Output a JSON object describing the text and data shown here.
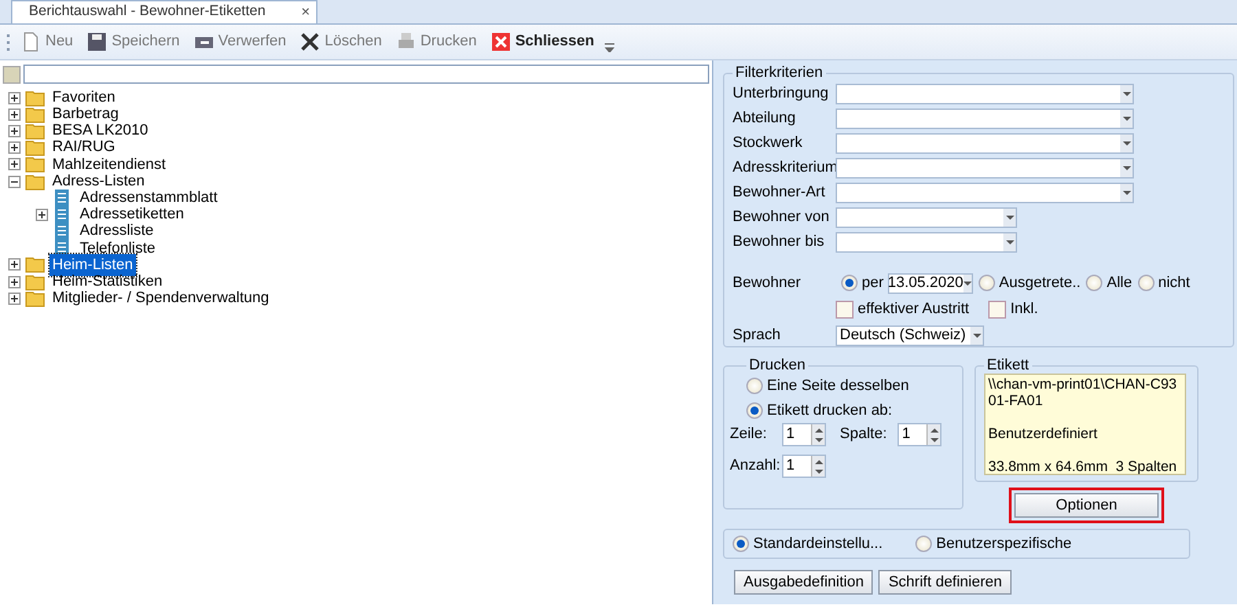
{
  "window": {
    "tab_title": "Berichtauswahl - Bewohner-Etiketten",
    "close_label": "×"
  },
  "toolbar": [
    {
      "kind": "new",
      "label": "Neu",
      "disabled": true
    },
    {
      "kind": "save",
      "label": "Speichern",
      "disabled": true
    },
    {
      "kind": "discard",
      "label": "Verwerfen",
      "disabled": true
    },
    {
      "kind": "delete",
      "label": "Löschen",
      "disabled": true
    },
    {
      "kind": "print",
      "label": "Drucken",
      "disabled": true
    },
    {
      "kind": "close",
      "label": "Schliessen",
      "disabled": false
    }
  ],
  "tree": [
    {
      "label": "Favoriten",
      "kind": "folder",
      "expanded": false,
      "selected": false
    },
    {
      "label": "Barbetrag",
      "kind": "folder",
      "expanded": false,
      "selected": false
    },
    {
      "label": "BESA LK2010",
      "kind": "folder",
      "expanded": false,
      "selected": false
    },
    {
      "label": "RAI/RUG",
      "kind": "folder",
      "expanded": false,
      "selected": false
    },
    {
      "label": "Mahlzeitendienst",
      "kind": "folder",
      "expanded": false,
      "selected": false
    },
    {
      "label": "Adress-Listen",
      "kind": "folder",
      "expanded": true,
      "selected": false,
      "children": [
        {
          "label": "Adressenstammblatt",
          "kind": "report",
          "selected": false
        },
        {
          "label": "Adressetiketten",
          "kind": "report",
          "expanded": false,
          "selected": false
        },
        {
          "label": "Adressliste",
          "kind": "report",
          "selected": false
        },
        {
          "label": "Telefonliste",
          "kind": "report",
          "selected": false
        }
      ]
    },
    {
      "label": "Heim-Listen",
      "kind": "folder",
      "expanded": false,
      "selected": true
    },
    {
      "label": "Heim-Statistiken",
      "kind": "folder",
      "expanded": false,
      "selected": false
    },
    {
      "label": "Mitglieder- / Spendenverwaltung",
      "kind": "folder",
      "expanded": false,
      "selected": false
    }
  ],
  "filter": {
    "title": "Filterkriterien",
    "fields": [
      {
        "label": "Unterbringung",
        "kind": "wide"
      },
      {
        "label": "Abteilung",
        "kind": "wide"
      },
      {
        "label": "Stockwerk",
        "kind": "wide"
      },
      {
        "label": "Adresskriterium",
        "kind": "wide"
      },
      {
        "label": "Bewohner-Art",
        "kind": "wide"
      },
      {
        "label": "Bewohner von",
        "kind": "narrow"
      },
      {
        "label": "Bewohner bis",
        "kind": "narrow"
      }
    ],
    "bewohner_label": "Bewohner",
    "bewohner_options": [
      {
        "label": "per",
        "selected": true,
        "date": "13.05.2020"
      },
      {
        "label": "Ausgetrete..",
        "selected": false
      },
      {
        "label": "Alle",
        "selected": false
      },
      {
        "label": "nicht",
        "selected": false
      }
    ],
    "checkboxes": [
      {
        "label": "effektiver Austritt",
        "checked": false
      },
      {
        "label": "Inkl.",
        "checked": false
      }
    ],
    "sprache_label": "Sprach",
    "sprache_value": "Deutsch (Schweiz)"
  },
  "drucken": {
    "title": "Drucken",
    "options": [
      {
        "label": "Eine Seite desselben",
        "selected": false
      },
      {
        "label": "Etikett drucken ab:",
        "selected": true
      }
    ],
    "spinners": [
      {
        "label": "Zeile:",
        "value": "1"
      },
      {
        "label": "Spalte:",
        "value": "1"
      },
      {
        "label": "Anzahl:",
        "value": "1"
      }
    ]
  },
  "etikett": {
    "title": "Etikett",
    "lines": [
      "\\\\chan-vm-print01\\CHAN-C9301-FA01",
      "Benutzerdefiniert",
      "33.8mm x 64.6mm  3 Spalten"
    ],
    "button": "Optionen",
    "highlighted": true
  },
  "settings": [
    {
      "label": "Standardeinstellu...",
      "selected": true
    },
    {
      "label": "Benutzerspezifische",
      "selected": false
    }
  ],
  "buttons": [
    "Ausgabedefinition",
    "Schrift definieren"
  ]
}
